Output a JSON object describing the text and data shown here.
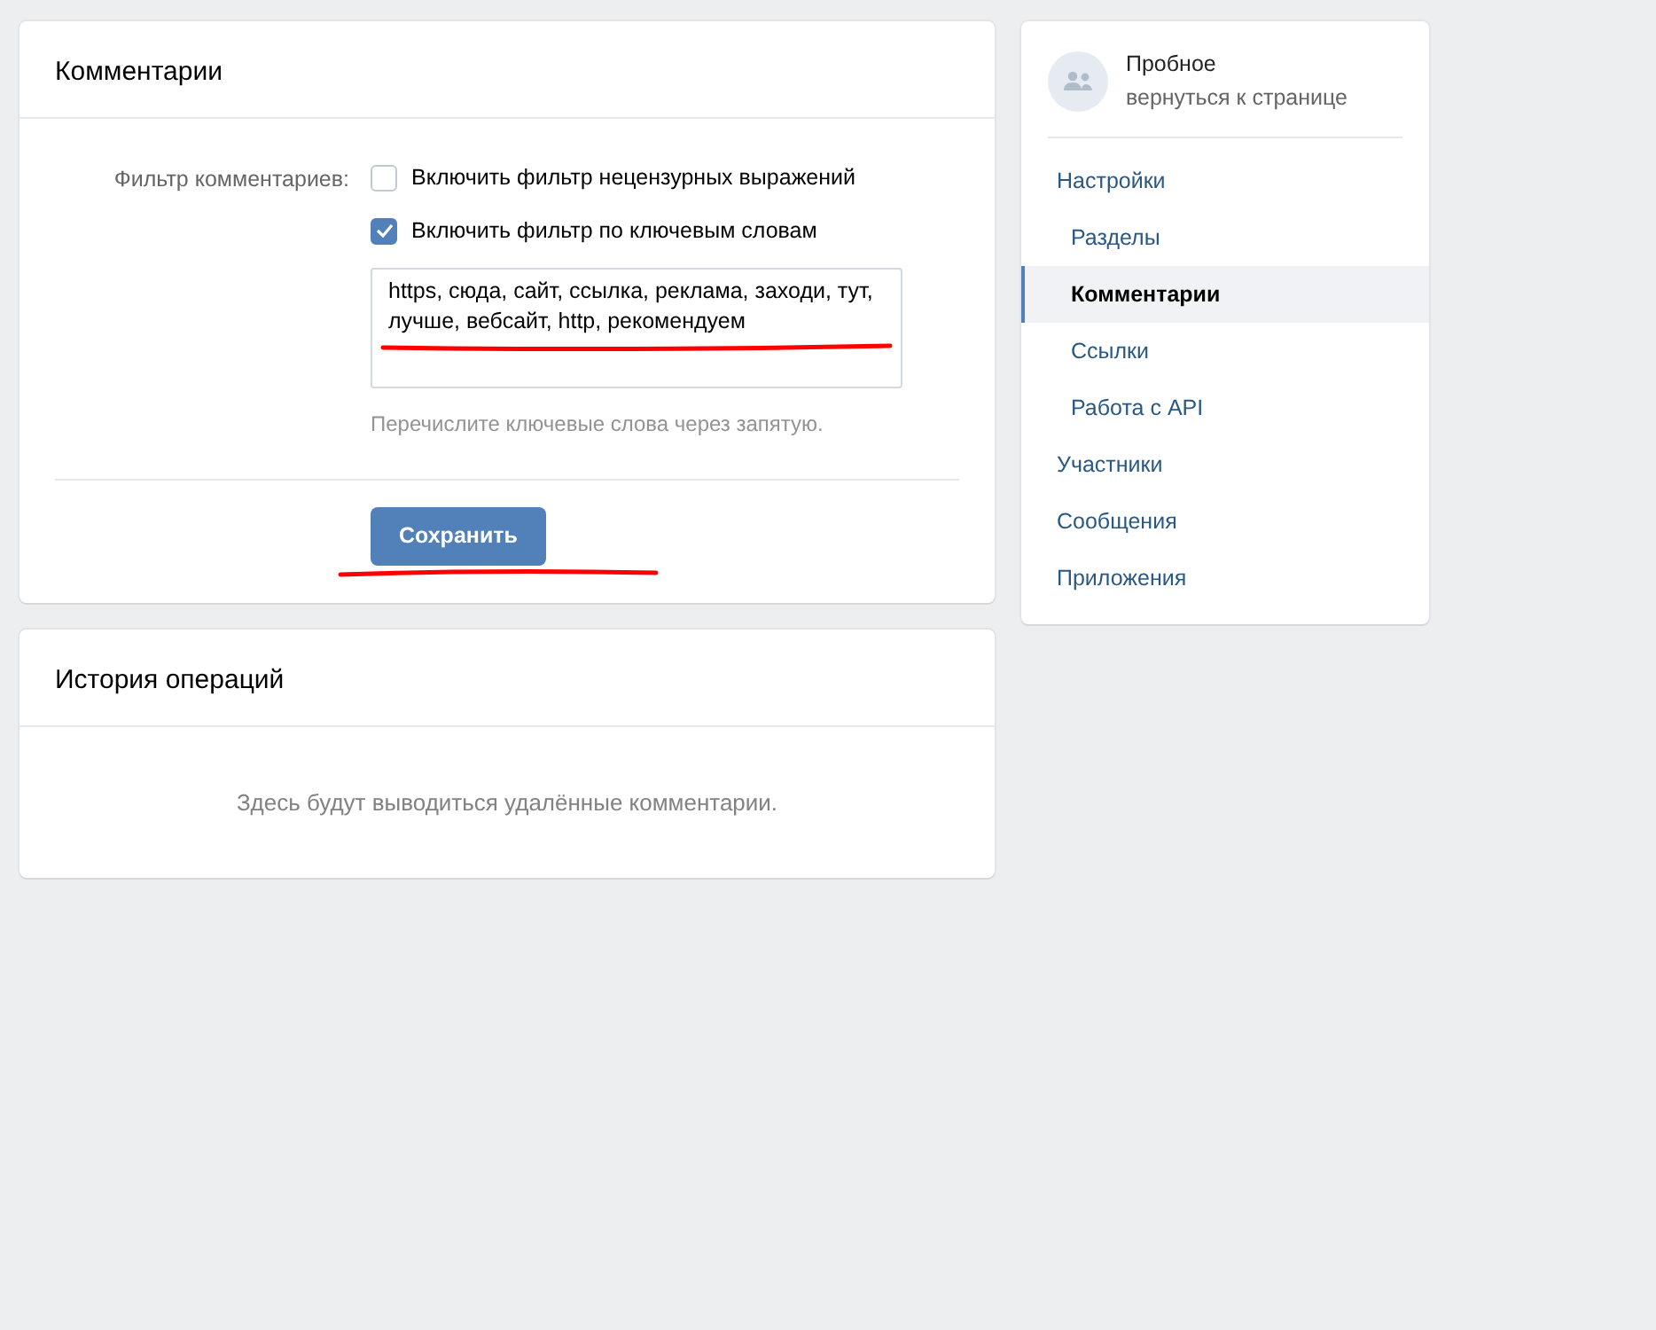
{
  "filter_card": {
    "title": "Комментарии",
    "filter_label": "Фильтр комментариев:",
    "options": [
      {
        "label": "Включить фильтр нецензурных выражений",
        "checked": false
      },
      {
        "label": "Включить фильтр по ключевым словам",
        "checked": true
      }
    ],
    "keywords": {
      "value": "https, сюда, сайт, ссылка, реклама, заходи, тут, лучше, вебсайт, http, рекомендуем"
    },
    "hint": "Перечислите ключевые слова через запятую.",
    "save_button": "Сохранить"
  },
  "history_card": {
    "title": "История операций",
    "empty_text": "Здесь будут выводиться удалённые комментарии."
  },
  "sidebar": {
    "community": {
      "name": "Пробное",
      "back_link": "вернуться к странице"
    },
    "items": [
      {
        "label": "Настройки",
        "selected": false,
        "children": [
          {
            "label": "Разделы",
            "selected": false
          },
          {
            "label": "Комментарии",
            "selected": true
          },
          {
            "label": "Ссылки",
            "selected": false
          },
          {
            "label": "Работа с API",
            "selected": false
          }
        ]
      },
      {
        "label": "Участники",
        "selected": false
      },
      {
        "label": "Сообщения",
        "selected": false
      },
      {
        "label": "Приложения",
        "selected": false
      }
    ]
  }
}
